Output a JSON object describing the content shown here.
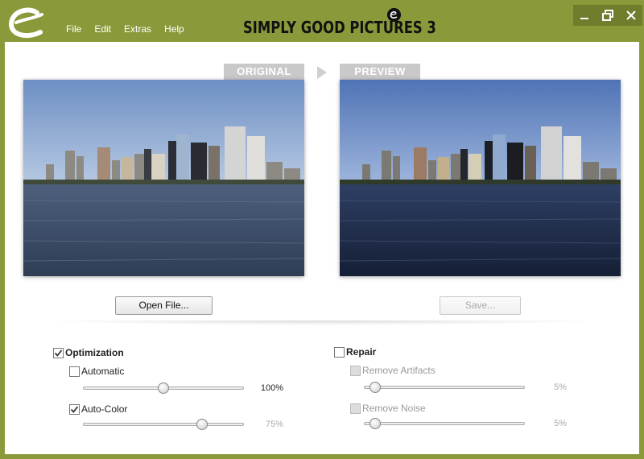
{
  "window": {
    "title": "SIMPLY GOOD PICTURES 3",
    "menu": [
      "File",
      "Edit",
      "Extras",
      "Help"
    ],
    "accent_color": "#8a9a3a",
    "controls": [
      "minimize-icon",
      "maximize-icon",
      "close-icon"
    ]
  },
  "panels": {
    "original_label": "ORIGINAL",
    "preview_label": "PREVIEW"
  },
  "buttons": {
    "open_file": "Open File...",
    "save": "Save..."
  },
  "optimization": {
    "label": "Optimization",
    "checked": true,
    "automatic": {
      "label": "Automatic",
      "checked": false,
      "value_text": "100%",
      "value": 100,
      "range": [
        0,
        200
      ]
    },
    "auto_color": {
      "label": "Auto-Color",
      "checked": true,
      "value_text": "75%",
      "value": 75,
      "range": [
        0,
        100
      ]
    }
  },
  "repair": {
    "label": "Repair",
    "checked": false,
    "remove_artifacts": {
      "label": "Remove Artifacts",
      "checked": false,
      "value_text": "5%",
      "value": 5,
      "range": [
        0,
        100
      ]
    },
    "remove_noise": {
      "label": "Remove Noise",
      "checked": false,
      "value_text": "5%",
      "value": 5,
      "range": [
        0,
        100
      ]
    }
  }
}
